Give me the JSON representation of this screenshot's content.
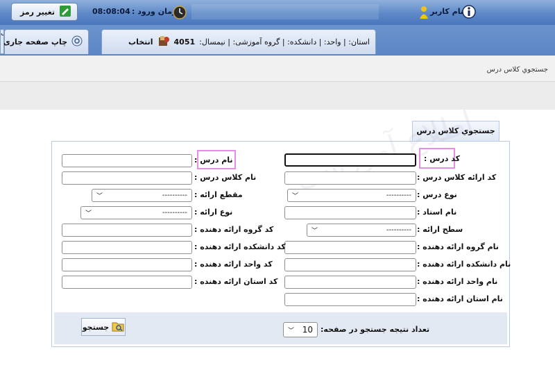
{
  "header": {
    "user_label": "نام کاربر",
    "login_time_label": "زمان ورود :",
    "login_time": "08:08:04",
    "change_password_label": "تغییر رمز",
    "info_icon": "info-icon",
    "user_icon": "user-icon",
    "clock_icon": "clock-icon"
  },
  "tabbar": {
    "context_text": "استان: | واحد: | دانشکده: | گروه آموزشی: | نیمسال:",
    "semester": "4051",
    "select_label": "انتخاب",
    "print_label": "چاپ صفحه جاری",
    "edge_label": "ب"
  },
  "breadcrumb": "جستجوي كلاس درس",
  "panel": {
    "title": "جستجوي كلاس درس",
    "watermark": "اطلاع آموزشی",
    "right_fields": {
      "course_code": "كد درس :",
      "class_offer_code": "كد ارائه كلاس درس :",
      "course_type": "نوع درس :",
      "teacher_name": "نام استاد :",
      "offer_level": "سطح ارائه :",
      "group_name": "نام گروه ارائه دهنده :",
      "faculty_name": "نام دانشكده ارائه دهنده :",
      "unit_name": "نام واحد ارائه دهنده :",
      "province_name": "نام استان ارائه دهنده :"
    },
    "left_fields": {
      "course_name": "نام درس :",
      "class_name": "نام كلاس درس :",
      "offer_section": "مقطع ارائه :",
      "offer_type": "نوع ارائه :",
      "group_code": "كد گروه ارائه دهنده :",
      "faculty_code": "كد دانشكده ارائه دهنده :",
      "unit_code": "كد واحد ارائه دهنده :",
      "province_code": "كد استان ارائه دهنده :"
    },
    "select_placeholder": "----------",
    "results_per_page_label": "تعداد نتیجه جستجو در صفحه:",
    "results_per_page_value": "10",
    "search_button_label": "جستجو"
  }
}
